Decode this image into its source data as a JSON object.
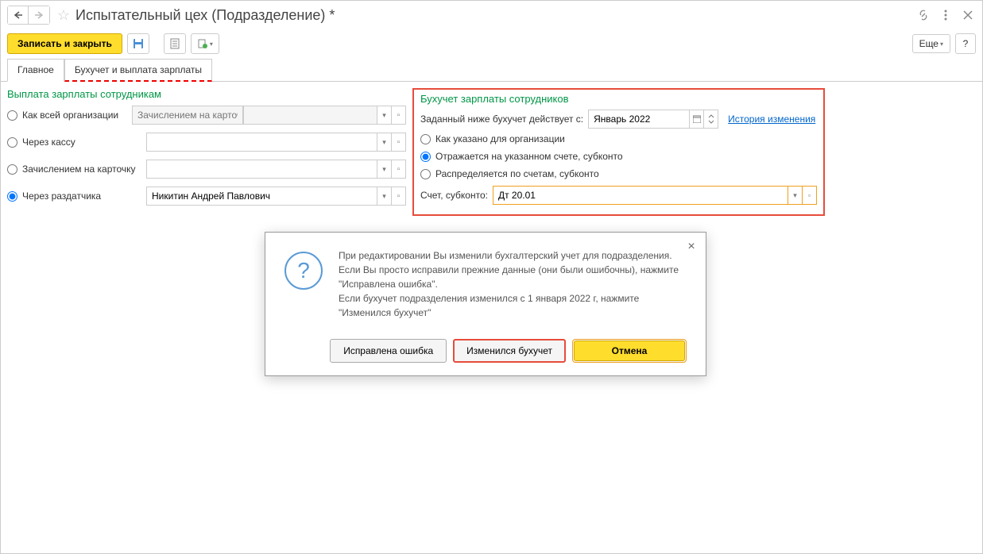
{
  "title": "Испытательный цех (Подразделение) *",
  "toolbar": {
    "save_close": "Записать и закрыть",
    "more": "Еще"
  },
  "tabs": {
    "main": "Главное",
    "accounting": "Бухучет и выплата зарплаты"
  },
  "left": {
    "title": "Выплата зарплаты сотрудникам",
    "opt_org": "Как всей организации",
    "opt_org_placeholder": "Зачислением на карточк",
    "opt_cash": "Через кассу",
    "opt_card": "Зачислением на карточку",
    "opt_distributor": "Через раздатчика",
    "distributor_value": "Никитин Андрей Павлович"
  },
  "right": {
    "title": "Бухучет зарплаты сотрудников",
    "effective_label": "Заданный ниже бухучет действует с:",
    "effective_value": "Январь 2022",
    "history_link": "История изменения",
    "opt_as_org": "Как указано для организации",
    "opt_account": "Отражается на указанном счете, субконто",
    "opt_distributed": "Распределяется по счетам, субконто",
    "account_label": "Счет, субконто:",
    "account_value": "Дт 20.01"
  },
  "modal": {
    "line1": "При редактировании Вы изменили бухгалтерский учет для подразделения.",
    "line2": "Если Вы просто исправили прежние данные (они были ошибочны), нажмите \"Исправлена ошибка\".",
    "line3": "Если бухучет подразделения изменился с 1 января 2022 г, нажмите \"Изменился бухучет\"",
    "btn_fixed": "Исправлена ошибка",
    "btn_changed": "Изменился бухучет",
    "btn_cancel": "Отмена"
  }
}
